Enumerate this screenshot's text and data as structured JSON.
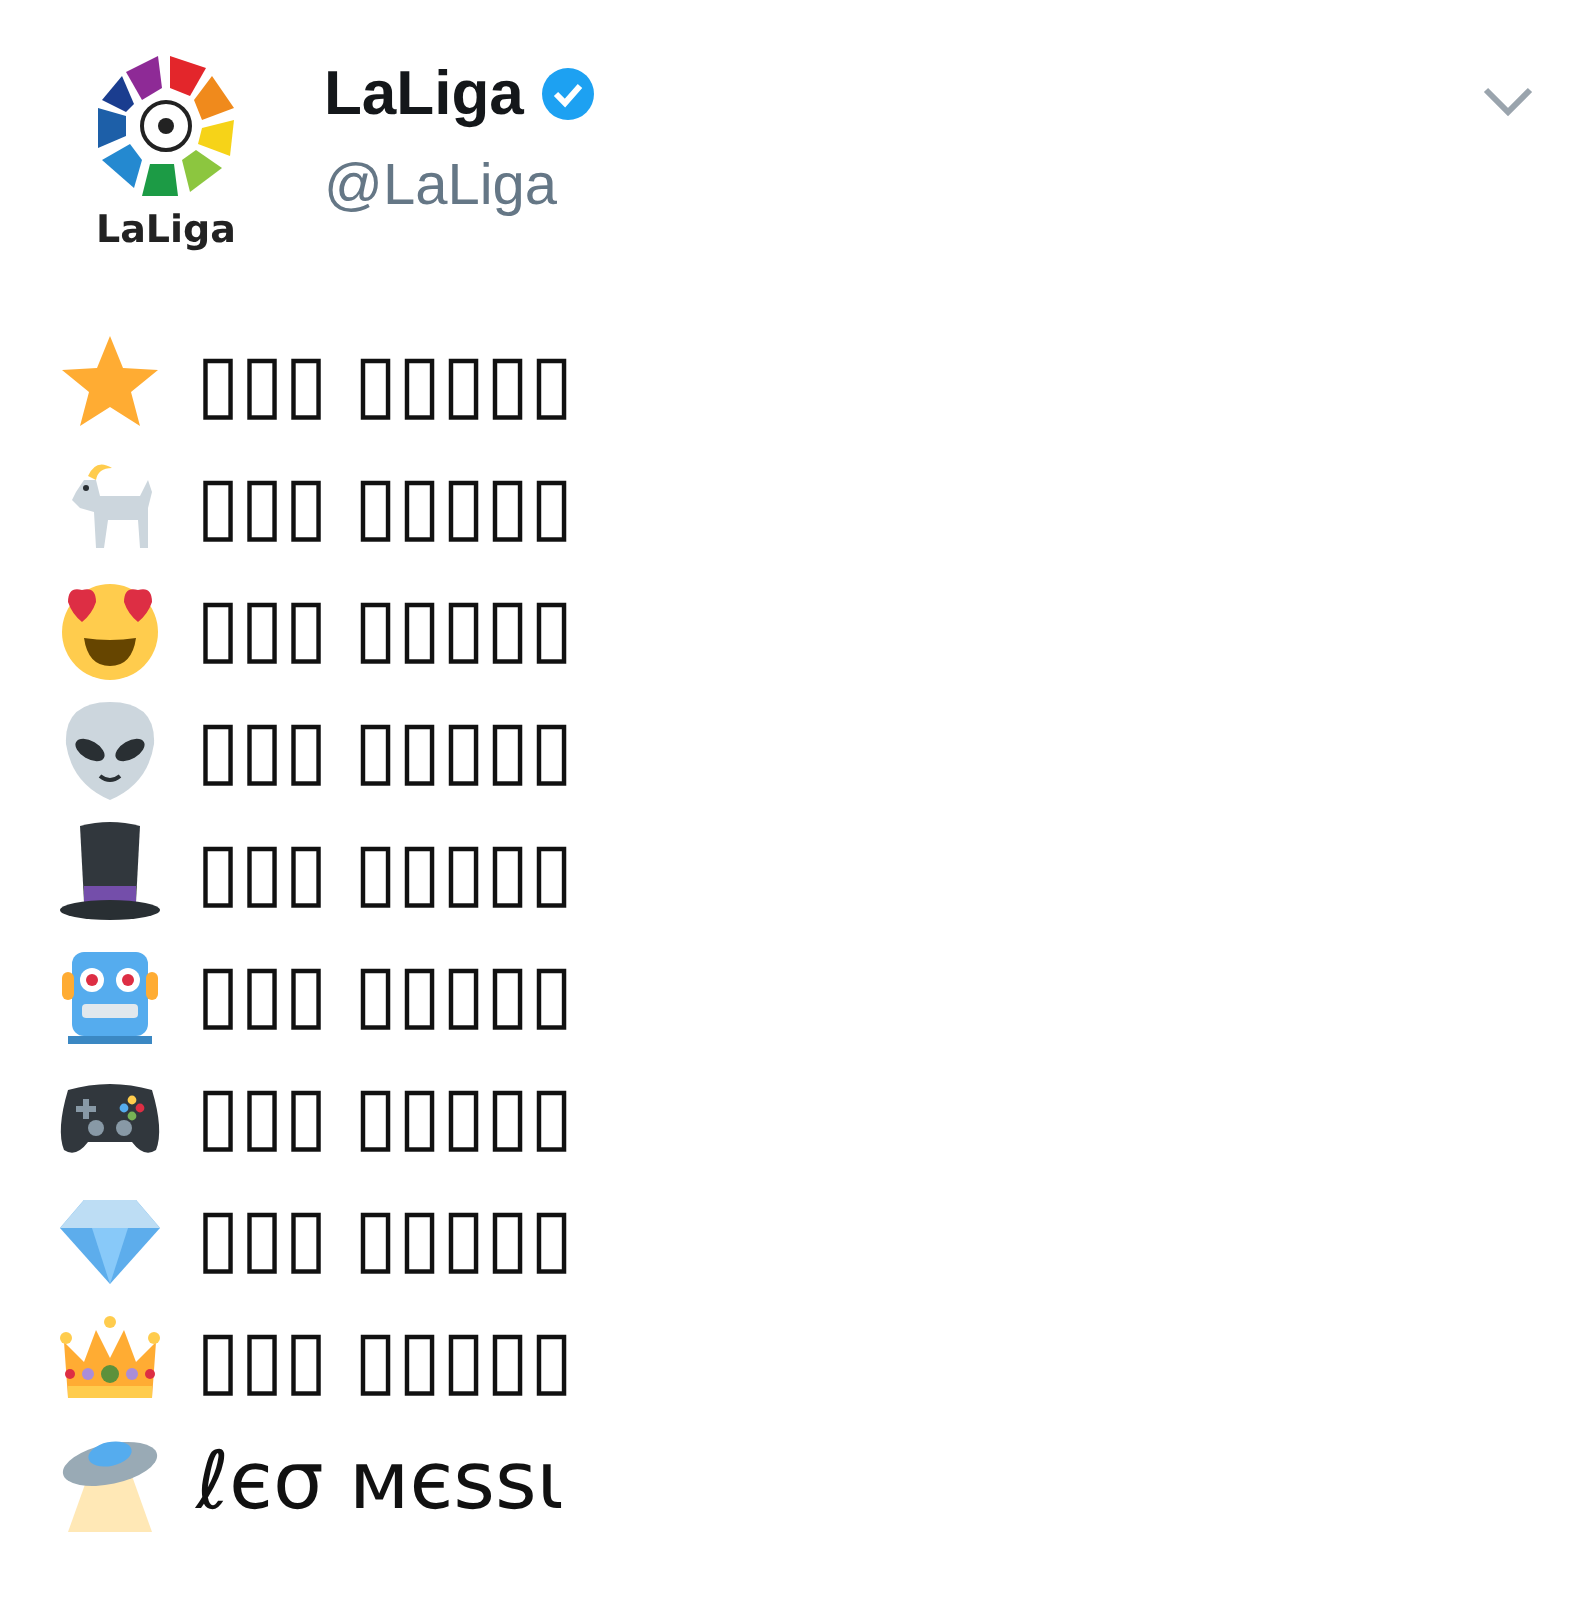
{
  "tweet": {
    "logo_text": "LaLiga",
    "name": "LaLiga",
    "verified": true,
    "handle": "@LaLiga",
    "lines": [
      {
        "text": "▯▯▯ ▯▯▯▯▯"
      },
      {
        "text": "▯▯▯ ▯▯▯▯▯"
      },
      {
        "text": "▯▯▯ ▯▯▯▯▯"
      },
      {
        "text": "▯▯▯ ▯▯▯▯▯"
      },
      {
        "text": "▯▯▯ ▯▯▯▯▯"
      },
      {
        "text": "▯▯▯ ▯▯▯▯▯"
      },
      {
        "text": "▯▯▯ ▯▯▯▯▯"
      },
      {
        "text": "▯▯▯ ▯▯▯▯▯"
      },
      {
        "text": "▯▯▯ ▯▯▯▯▯"
      },
      {
        "text": "ℓєσ мєѕѕι"
      }
    ]
  }
}
